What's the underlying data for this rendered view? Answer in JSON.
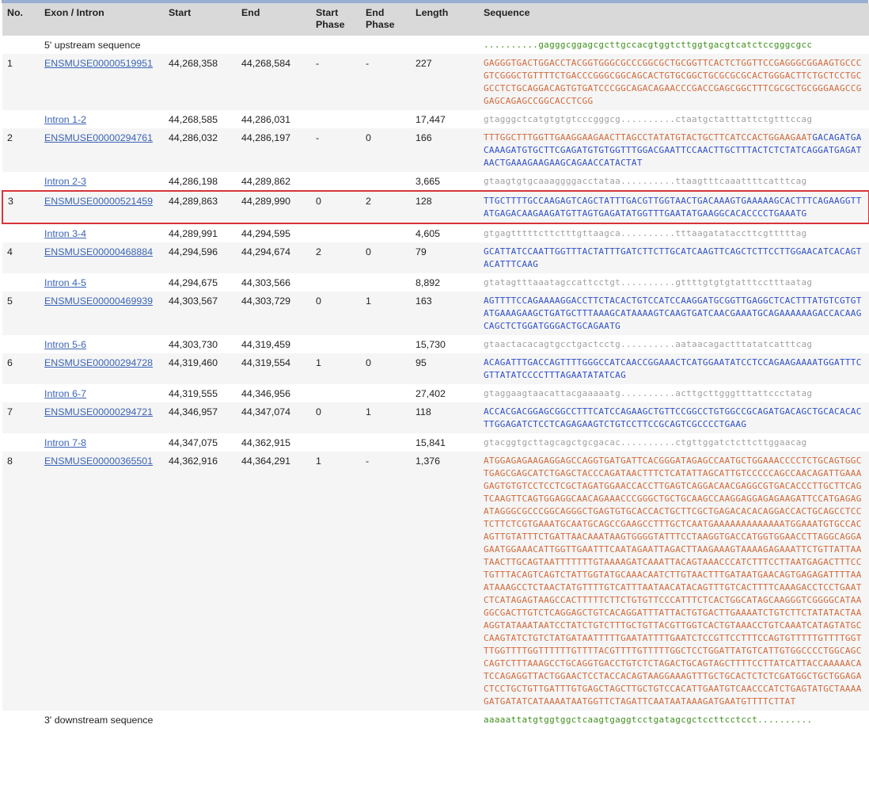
{
  "headers": {
    "no": "No.",
    "exon_intron": "Exon / Intron",
    "start": "Start",
    "end": "End",
    "start_phase": "Start Phase",
    "end_phase": "End Phase",
    "length": "Length",
    "sequence": "Sequence"
  },
  "upstream": {
    "label": "5' upstream sequence",
    "sequence": "..........gagggcggagcgcttgccacgtggtcttggtgacgtcatctccgggcgcc"
  },
  "downstream": {
    "label": "3' downstream sequence",
    "sequence": "aaaaattatgtggtggctcaagtgaggtcctgatagcgctccttcctcct.........."
  },
  "rows": [
    {
      "type": "exon",
      "no": "1",
      "id": "ENSMUSE00000519951",
      "start": "44,268,358",
      "end": "44,268,584",
      "start_phase": "-",
      "end_phase": "-",
      "length": "227",
      "sequence": "GAGGGTGACTGGACCTACGGTGGGCGCCCGGCGCTGCGGTTCACTCTGGTTCCGAGGGCGGAAGTGCCCGTCGGGCTGTTTTCTGACCCGGGCGGCAGCACTGTGCGGCTGCGCGCGCACTGGGACTTCTGCTCCTGCGCCTCTGCAGGACAGTGTGATCCCGGCAGACAGAACCCGACCGAGCGGCTTTCGCGCTGCGGGAAGCCGGAGCAGAGCCGGCACCTCGG",
      "color": "orange"
    },
    {
      "type": "intron",
      "id": "Intron 1-2",
      "start": "44,268,585",
      "end": "44,286,031",
      "length": "17,447",
      "sequence": "gtagggctcatgtgtgtcccgggcg..........ctaatgctatttattctgtttccag"
    },
    {
      "type": "exon",
      "no": "2",
      "id": "ENSMUSE00000294761",
      "start": "44,286,032",
      "end": "44,286,197",
      "start_phase": "-",
      "end_phase": "0",
      "length": "166",
      "seq_utr": "TTTGGCTTTGGTTGAAGGAAGAACTTAGCCTATATGTACTGCTTCATCCACTGGAAGAAT",
      "sequence": "GACAGATGACAAAGATGTGCTTCGAGATGTGTGGTTTGGACGAATTCCAACTTGCTTTACTCTCTATCAGGATGAGATAACTGAAAGAAGAAGCAGAACCATACTAT",
      "color": "mixed"
    },
    {
      "type": "intron",
      "id": "Intron 2-3",
      "start": "44,286,198",
      "end": "44,289,862",
      "length": "3,665",
      "sequence": "gtaagtgtgcaaaggggacctataa..........ttaagtttcaaattttcatttcag"
    },
    {
      "type": "exon",
      "no": "3",
      "id": "ENSMUSE00000521459",
      "start": "44,289,863",
      "end": "44,289,990",
      "start_phase": "0",
      "end_phase": "2",
      "length": "128",
      "sequence": "TTGCTTTTGCCAAGAGTCAGCTATTTGACGTTGGTAACTGACAAAGTGAAAAAGCACTTTCAGAAGGTTATGAGACAAGAAGATGTTAGTGAGATATGGTTTGAATATGAAGGCACACCCCTGAAATG",
      "color": "blue",
      "highlight": true
    },
    {
      "type": "intron",
      "id": "Intron 3-4",
      "start": "44,289,991",
      "end": "44,294,595",
      "length": "4,605",
      "sequence": "gtgagtttttcttctttgttaagca..........tttaagatataccttcgtttttag"
    },
    {
      "type": "exon",
      "no": "4",
      "id": "ENSMUSE00000468884",
      "start": "44,294,596",
      "end": "44,294,674",
      "start_phase": "2",
      "end_phase": "0",
      "length": "79",
      "sequence": "GCATTATCCAATTGGTTTACTATTTGATCTTCTTGCATCAAGTTCAGCTCTTCCTTGGAACATCACAGTACATTTCAAG",
      "color": "blue"
    },
    {
      "type": "intron",
      "id": "Intron 4-5",
      "start": "44,294,675",
      "end": "44,303,566",
      "length": "8,892",
      "sequence": "gtatagtttaaatagccattcctgt..........gttttgtgtgtatttcctttaatag"
    },
    {
      "type": "exon",
      "no": "5",
      "id": "ENSMUSE00000469939",
      "start": "44,303,567",
      "end": "44,303,729",
      "start_phase": "0",
      "end_phase": "1",
      "length": "163",
      "sequence": "AGTTTTCCAGAAAAGGACCTTCTACACTGTCCATCCAAGGATGCGGTTGAGGCTCACTTTATGTCGTGTATGAAAGAAGCTGATGCTTTAAAGCATAAAAGTCAAGTGATCAACGAAATGCAGAAAAAAGACCACAAGCAGCTCTGGATGGGACTGCAGAATG",
      "color": "blue"
    },
    {
      "type": "intron",
      "id": "Intron 5-6",
      "start": "44,303,730",
      "end": "44,319,459",
      "length": "15,730",
      "sequence": "gtaactacacagtgcctgactcctg..........aataacagactttatatcatttcag"
    },
    {
      "type": "exon",
      "no": "6",
      "id": "ENSMUSE00000294728",
      "start": "44,319,460",
      "end": "44,319,554",
      "start_phase": "1",
      "end_phase": "0",
      "length": "95",
      "sequence": "ACAGATTTGACCAGTTTTGGGCCATCAACCGGAAACTCATGGAATATCCTCCAGAAGAAAATGGATTTCGTTATATCCCCTTTAGAATATATCAG",
      "color": "blue"
    },
    {
      "type": "intron",
      "id": "Intron 6-7",
      "start": "44,319,555",
      "end": "44,346,956",
      "length": "27,402",
      "sequence": "gtaggaagtaacattacgaaaaatg..........acttgcttgggtttattccctatag"
    },
    {
      "type": "exon",
      "no": "7",
      "id": "ENSMUSE00000294721",
      "start": "44,346,957",
      "end": "44,347,074",
      "start_phase": "0",
      "end_phase": "1",
      "length": "118",
      "sequence": "ACCACGACGGAGCGGCCTTTCATCCAGAAGCTGTTCCGGCCTGTGGCCGCAGATGACAGCTGCACACACTTGGAGATCTCCTCAGAGAAGTCTGTCCTTCCGCAGTCGCCCCTGAAG",
      "color": "blue"
    },
    {
      "type": "intron",
      "id": "Intron 7-8",
      "start": "44,347,075",
      "end": "44,362,915",
      "length": "15,841",
      "sequence": "gtacggtgcttagcagctgcgacac..........ctgttggatctcttcttggaacag"
    },
    {
      "type": "exon",
      "no": "8",
      "id": "ENSMUSE00000365501",
      "start": "44,362,916",
      "end": "44,364,291",
      "start_phase": "1",
      "end_phase": "-",
      "length": "1,376",
      "sequence": "ATGGAGAGAAGAGGAGCCAGGTGATGATTCACGGGATAGAGCCAATGCTGGAAACCCCTCTGCAGTGGCTGAGCGAGCATCTGAGCTACCCAGATAACTTTCTCATATTAGCATTGTCCCCCAGCCAACAGATTGAAAGAGTGTGTCCTCCTCGCTAGATGGAACCACCTTGAGTCAGGACAACGAGGCGTGACACCCTTGCTTCAGTCAAGTTCAGTGGAGGCAACAGAAACCCGGGCTGCTGCAAGCCAAGGAGGAGAGAAGATTCCATGAGAGATAGGGCGCCCGGCAGGGCTGAGTGTGCACCACTGCTTCGCTGAGACACACAGGACCACTGCAGCCTCCTCTTCTCGTGAAATGCAATGCAGCCGAAGCCTTTGCTCAATGAAAAAAAAAAAAATGGAAATGTGCCACAGTTGTATTTCTGATTAACAAATAAGTGGGGTATTTCCTAAGGTGACCATGGTGGAACCTTAGGCAGGAGAATGGAAACATTGGTTGAATTTCAATAGAATTAGACTTAAGAAAGTAAAAGAGAAATTCTGTTATTAATAACTTGCAGTAATTTTTTTGTAAAAGATCAAATTACAGTAAACCCATCTTTCCTTAATGAGACTTTCCTGTTTACAGTCAGTCTATTGGTATGCAAACAATCTTGTAACTTTGATAATGAACAGTGAGAGATTTTAAATAAAGCCTCTAACTATGTTTTGTCATTTAATAACATACAGTTTGTCACTTTTCAAAGACCTCCTGAATCTCATAGAGTAAGCCACTTTTTCTTCTGTGTTCCCATTTCTCACTGGCATAGCAAGGGTCGGGGCATAAGGCGACTTGTCTCAGGAGCTGTCACAGGATTTATTACTGTGACTTGAAAATCTGTCTTCTATATACTAAAGGTATAAATAATCCTATCTGTCTTTGCTGTTACGTTGGTCACTGTAAACCTGTCAAATCATAGTATGCCAAGTATCTGTCTATGATAATTTTTGAATATTTTGAATCTCCGTTCCTTTCCAGTGTTTTTGTTTTGGTTTGGTTTTGGTTTTTTGTTTTACGTTTTGTTTTTGGCTCCTGGATTATGTCATTGTGGCCCCTGGCAGCCAGTCTTTAAAGCCTGCAGGTGACCTGTCTCTAGACTGCAGTAGCTTTTCCTTATCATTACCAAAAACATCCAGAGGTTACTGGAACTCCTACCACAGTAAGGAAAGTTTGCTGCACTCTCTCGATGGCTGCTGGAGACTCCTGCTGTTGATTTGTGAGCTAGCTTGCTGTCCACATTGAATGTCAACCCATCTGAGTATGCTAAAAGATGATATCATAAAATAATGGTTCTAGATTCAATAATAAAGATGAATGTTTTCTTAT",
      "color": "orange"
    }
  ]
}
